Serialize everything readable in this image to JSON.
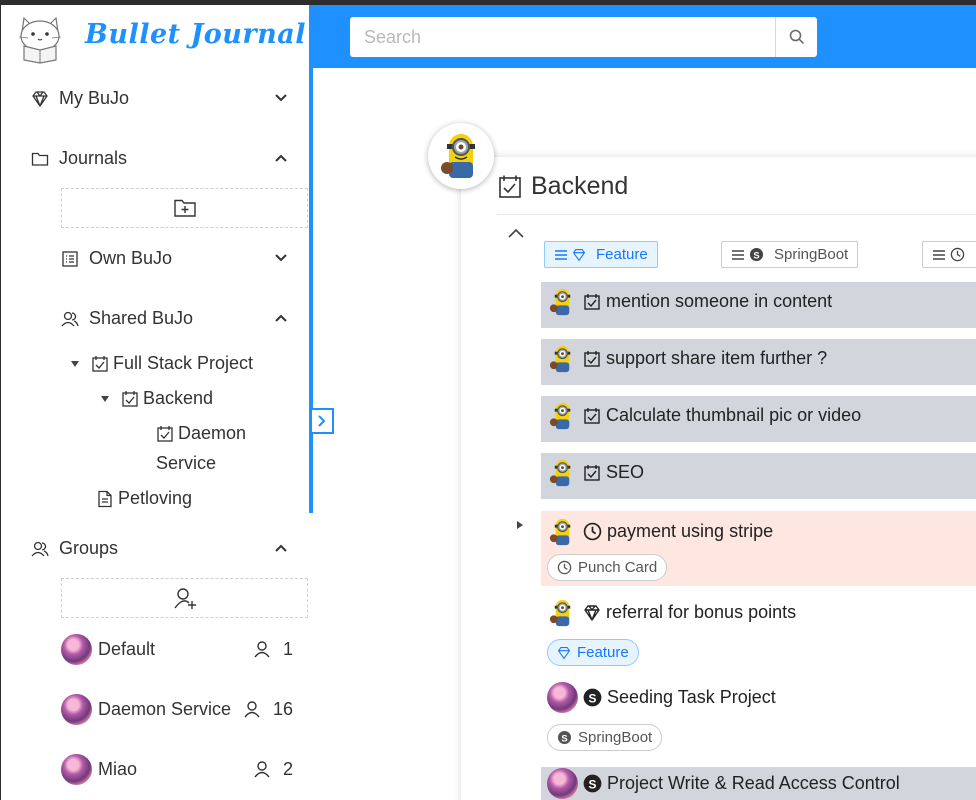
{
  "brand": {
    "name": "Bullet Journal"
  },
  "sidebar": {
    "my_bujo": "My BuJo",
    "journals": "Journals",
    "own_bujo": "Own BuJo",
    "shared_bujo": "Shared BuJo",
    "tree": {
      "full_stack": "Full Stack Project",
      "backend": "Backend",
      "daemon_line1": "Daemon",
      "daemon_line2": "Service",
      "petloving": "Petloving"
    },
    "groups_label": "Groups",
    "groups": [
      {
        "name": "Default",
        "count": "1"
      },
      {
        "name": "Daemon Service",
        "count": "16"
      },
      {
        "name": "Miao",
        "count": "2"
      }
    ]
  },
  "search": {
    "placeholder": "Search"
  },
  "project": {
    "title": "Backend",
    "labels": [
      {
        "name": "Feature",
        "icon": "diamond-icon",
        "selected": true
      },
      {
        "name": "SpringBoot",
        "icon": "skype-icon",
        "selected": false
      }
    ],
    "items": [
      {
        "text": "mention someone in content",
        "type": "task",
        "bg": "grey"
      },
      {
        "text": "support share item further ?",
        "type": "task",
        "bg": "grey"
      },
      {
        "text": "Calculate thumbnail pic or video",
        "type": "task",
        "bg": "grey"
      },
      {
        "text": "SEO",
        "type": "task",
        "bg": "grey"
      },
      {
        "text": "payment using stripe",
        "type": "event",
        "bg": "peach",
        "tag": "Punch Card"
      },
      {
        "text": "referral for bonus points",
        "type": "note",
        "bg": "white",
        "tag": "Feature"
      },
      {
        "text": "Seeding Task Project",
        "type": "skype",
        "bg": "white",
        "tag": "SpringBoot"
      },
      {
        "text": "Project Write & Read Access Control",
        "type": "skype",
        "bg": "grey"
      }
    ]
  },
  "colors": {
    "primary": "#1e90ff",
    "grey_item": "#d3d5dc",
    "peach_item": "#fde7e0"
  }
}
